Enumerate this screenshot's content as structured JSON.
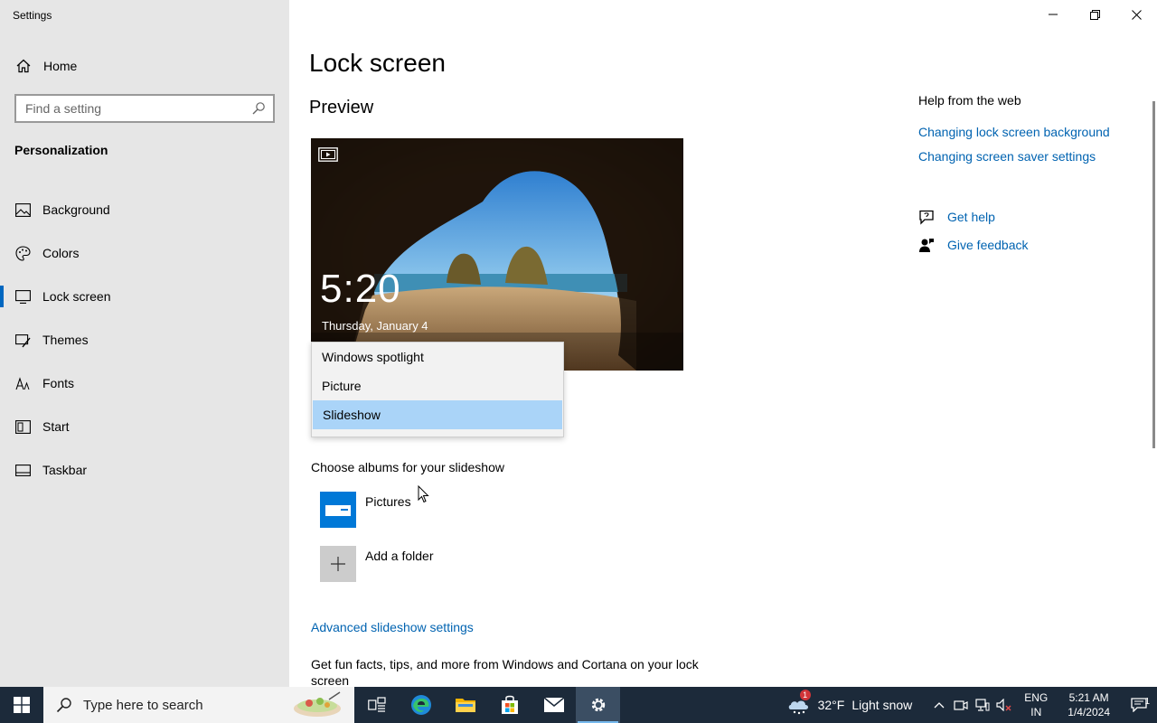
{
  "window": {
    "app_title": "Settings",
    "controls": {
      "minimize": "minimize-icon",
      "restore": "restore-icon",
      "close": "close-icon"
    }
  },
  "sidebar": {
    "home_label": "Home",
    "search_placeholder": "Find a setting",
    "section_heading": "Personalization",
    "items": [
      {
        "label": "Background",
        "icon": "image-icon"
      },
      {
        "label": "Colors",
        "icon": "palette-icon"
      },
      {
        "label": "Lock screen",
        "icon": "lock-screen-icon",
        "active": true
      },
      {
        "label": "Themes",
        "icon": "brush-icon"
      },
      {
        "label": "Fonts",
        "icon": "font-icon"
      },
      {
        "label": "Start",
        "icon": "start-icon"
      },
      {
        "label": "Taskbar",
        "icon": "taskbar-icon"
      }
    ]
  },
  "main": {
    "title": "Lock screen",
    "preview_heading": "Preview",
    "preview": {
      "time": "5:20",
      "date": "Thursday, January 4"
    },
    "background_dropdown": {
      "options": [
        "Windows spotlight",
        "Picture",
        "Slideshow"
      ],
      "selected": "Slideshow"
    },
    "albums_label": "Choose albums for your slideshow",
    "albums": [
      {
        "label": "Pictures"
      },
      {
        "label": "Add a folder"
      }
    ],
    "advanced_link": "Advanced slideshow settings",
    "tips_text": "Get fun facts, tips, and more from Windows and Cortana on your lock screen"
  },
  "help": {
    "title": "Help from the web",
    "links": [
      "Changing lock screen background",
      "Changing screen saver settings"
    ],
    "get_help": "Get help",
    "give_feedback": "Give feedback"
  },
  "taskbar": {
    "search_placeholder": "Type here to search",
    "weather": {
      "temp": "32°F",
      "condition": "Light snow",
      "badge": "1"
    },
    "lang": {
      "line1": "ENG",
      "line2": "IN"
    },
    "clock": {
      "time": "5:21 AM",
      "date": "1/4/2024"
    },
    "notification_count": "1"
  },
  "colors": {
    "accent": "#0063b1",
    "sidebar_bg": "#e6e6e6",
    "taskbar_bg": "#1c2a3a",
    "selected_option": "#aad4f8"
  }
}
